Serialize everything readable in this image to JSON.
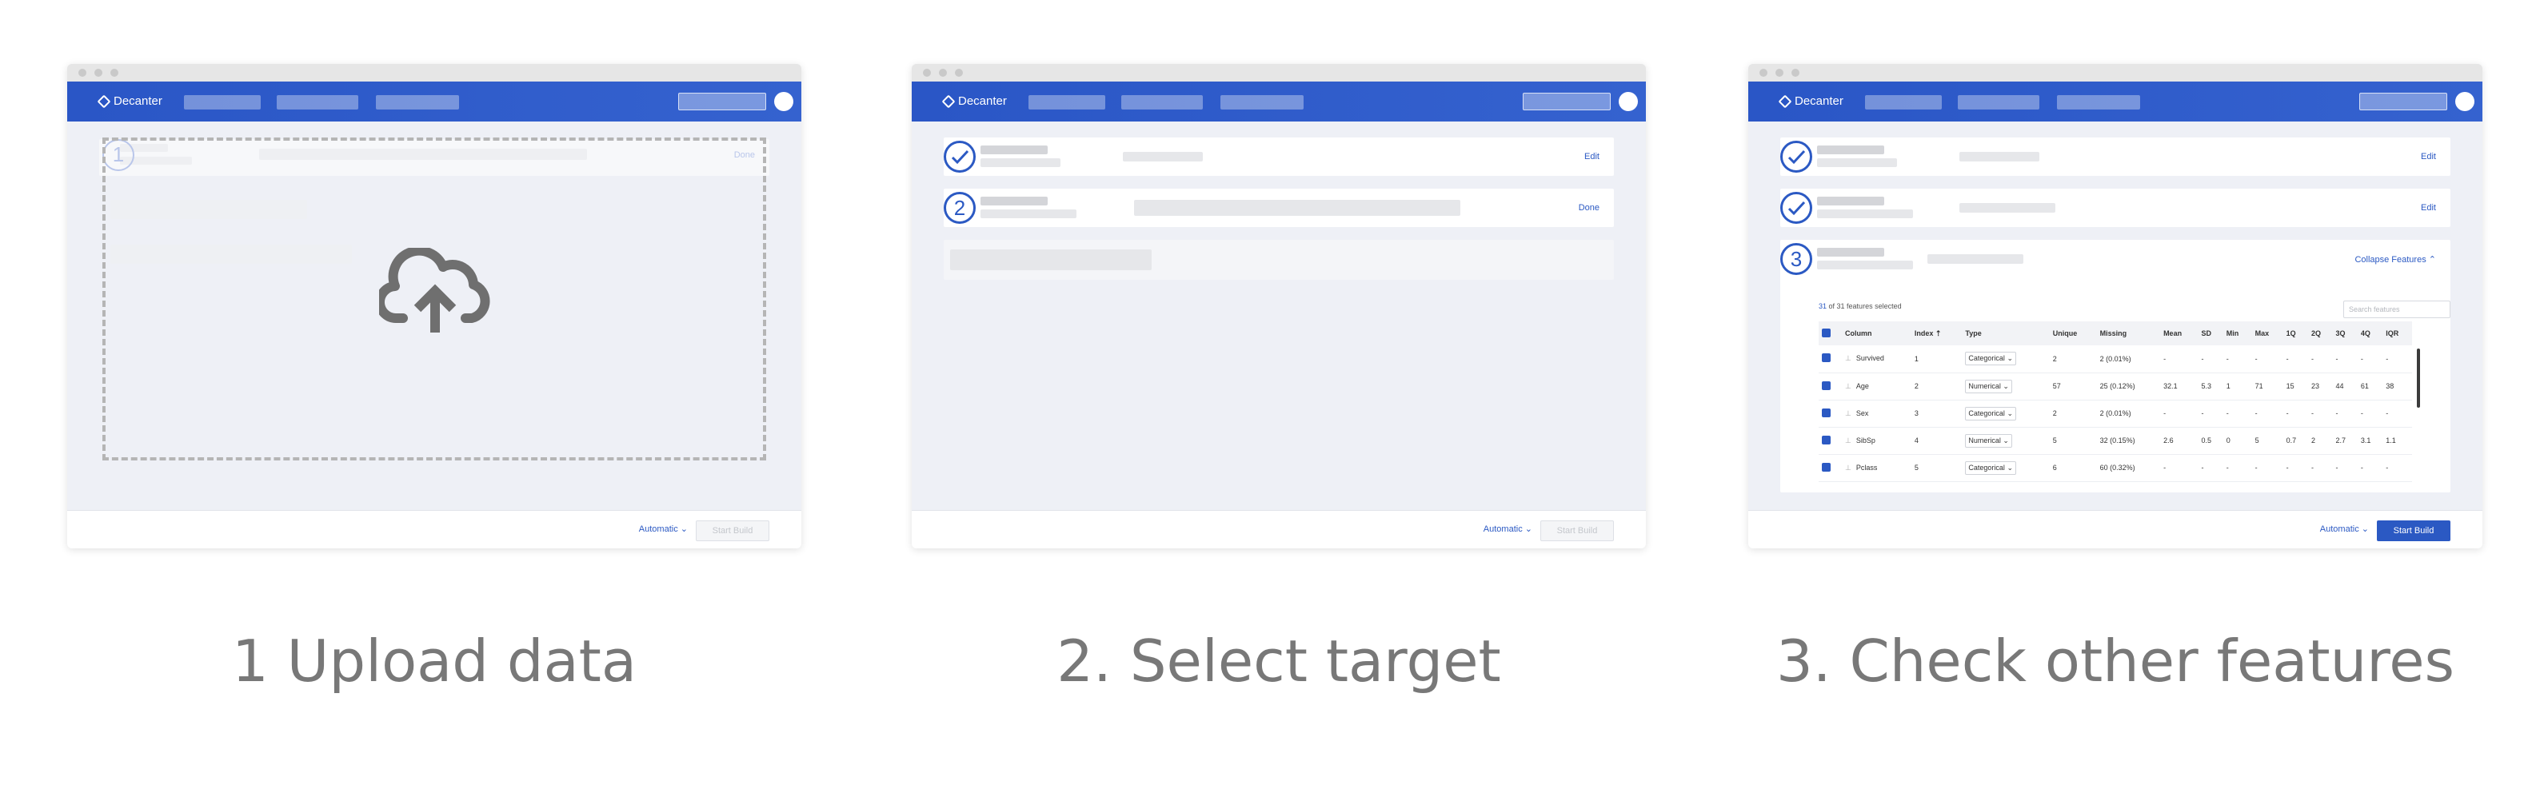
{
  "app": {
    "name": "Decanter"
  },
  "panels": [
    {
      "caption": "1 Upload data",
      "card_link": "Done",
      "step_number": "1",
      "footer": {
        "mode": "Automatic",
        "button": "Start Build"
      }
    },
    {
      "caption": "2. Select target",
      "cards": [
        {
          "link": "Edit"
        },
        {
          "step_number": "2",
          "link": "Done"
        }
      ],
      "footer": {
        "mode": "Automatic",
        "button": "Start Build"
      }
    },
    {
      "caption": "3. Check other features",
      "cards": [
        {
          "link": "Edit"
        },
        {
          "link": "Edit"
        },
        {
          "step_number": "3",
          "link": "Collapse Features"
        }
      ],
      "selection": {
        "count": "31",
        "text": "of 31 features selected"
      },
      "search_placeholder": "Search features",
      "table": {
        "headers": [
          "Column",
          "Index",
          "Type",
          "Unique",
          "Missing",
          "Mean",
          "SD",
          "Min",
          "Max",
          "1Q",
          "2Q",
          "3Q",
          "4Q",
          "IQR"
        ],
        "rows": [
          {
            "name": "Survived",
            "index": "1",
            "type": "Categorical",
            "unique": "2",
            "missing": "2 (0.01%)",
            "mean": "-",
            "sd": "-",
            "min": "-",
            "max": "-",
            "q1": "-",
            "q2": "-",
            "q3": "-",
            "q4": "-",
            "iqr": "-"
          },
          {
            "name": "Age",
            "index": "2",
            "type": "Numerical",
            "unique": "57",
            "missing": "25 (0.12%)",
            "mean": "32.1",
            "sd": "5.3",
            "min": "1",
            "max": "71",
            "q1": "15",
            "q2": "23",
            "q3": "44",
            "q4": "61",
            "iqr": "38"
          },
          {
            "name": "Sex",
            "index": "3",
            "type": "Categorical",
            "unique": "2",
            "missing": "2 (0.01%)",
            "mean": "-",
            "sd": "-",
            "min": "-",
            "max": "-",
            "q1": "-",
            "q2": "-",
            "q3": "-",
            "q4": "-",
            "iqr": "-"
          },
          {
            "name": "SibSp",
            "index": "4",
            "type": "Numerical",
            "unique": "5",
            "missing": "32 (0.15%)",
            "mean": "2.6",
            "sd": "0.5",
            "min": "0",
            "max": "5",
            "q1": "0.7",
            "q2": "2",
            "q3": "2.7",
            "q4": "3.1",
            "iqr": "1.1"
          },
          {
            "name": "Pclass",
            "index": "5",
            "type": "Categorical",
            "unique": "6",
            "missing": "60 (0.32%)",
            "mean": "-",
            "sd": "-",
            "min": "-",
            "max": "-",
            "q1": "-",
            "q2": "-",
            "q3": "-",
            "q4": "-",
            "iqr": "-"
          }
        ]
      },
      "footer": {
        "mode": "Automatic",
        "button": "Start Build"
      }
    }
  ],
  "colors": {
    "brand": "#2b59c3",
    "caption": "#787878"
  }
}
